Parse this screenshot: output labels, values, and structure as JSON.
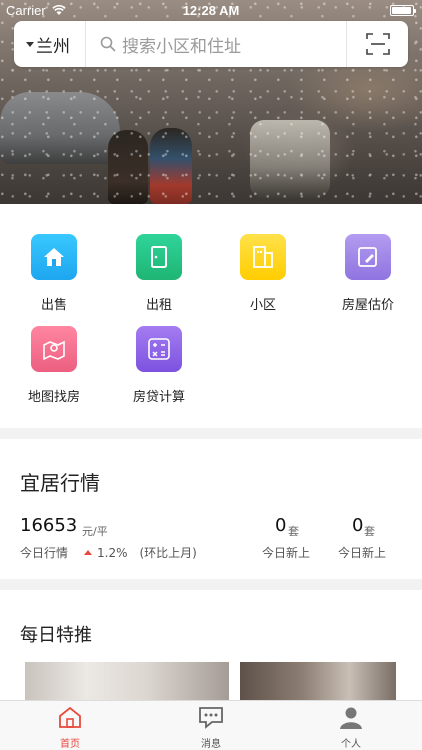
{
  "status": {
    "carrier": "Carrier",
    "time": "12:28 AM"
  },
  "header": {
    "city": "兰州",
    "search_placeholder": "搜索小区和住址"
  },
  "quick_actions": [
    {
      "label": "出售",
      "icon": "house-icon",
      "color": "#29b6f6"
    },
    {
      "label": "出租",
      "icon": "door-icon",
      "color": "#26c281"
    },
    {
      "label": "小区",
      "icon": "building-icon",
      "color": "#ffd000"
    },
    {
      "label": "房屋估价",
      "icon": "appraisal-icon",
      "color": "#9b7fe6"
    },
    {
      "label": "地图找房",
      "icon": "map-pin-icon",
      "color": "#f06b87"
    },
    {
      "label": "房贷计算",
      "icon": "calculator-icon",
      "color": "#8f63e8"
    }
  ],
  "market": {
    "title": "宜居行情",
    "price": "16653",
    "price_unit": "元/平",
    "price_caption": "今日行情",
    "change": "1.2%",
    "change_note": "(环比上月)",
    "new_sale": {
      "value": "0",
      "unit": "套",
      "caption": "今日新上"
    },
    "new_rent": {
      "value": "0",
      "unit": "套",
      "caption": "今日新上"
    }
  },
  "daily": {
    "title": "每日特推"
  },
  "tabs": [
    {
      "label": "首页",
      "active": true
    },
    {
      "label": "消息",
      "active": false
    },
    {
      "label": "个人",
      "active": false
    }
  ],
  "colors": {
    "accent": "#e8493d",
    "active_tab": "#e8493d",
    "tab_inactive": "#666666"
  }
}
